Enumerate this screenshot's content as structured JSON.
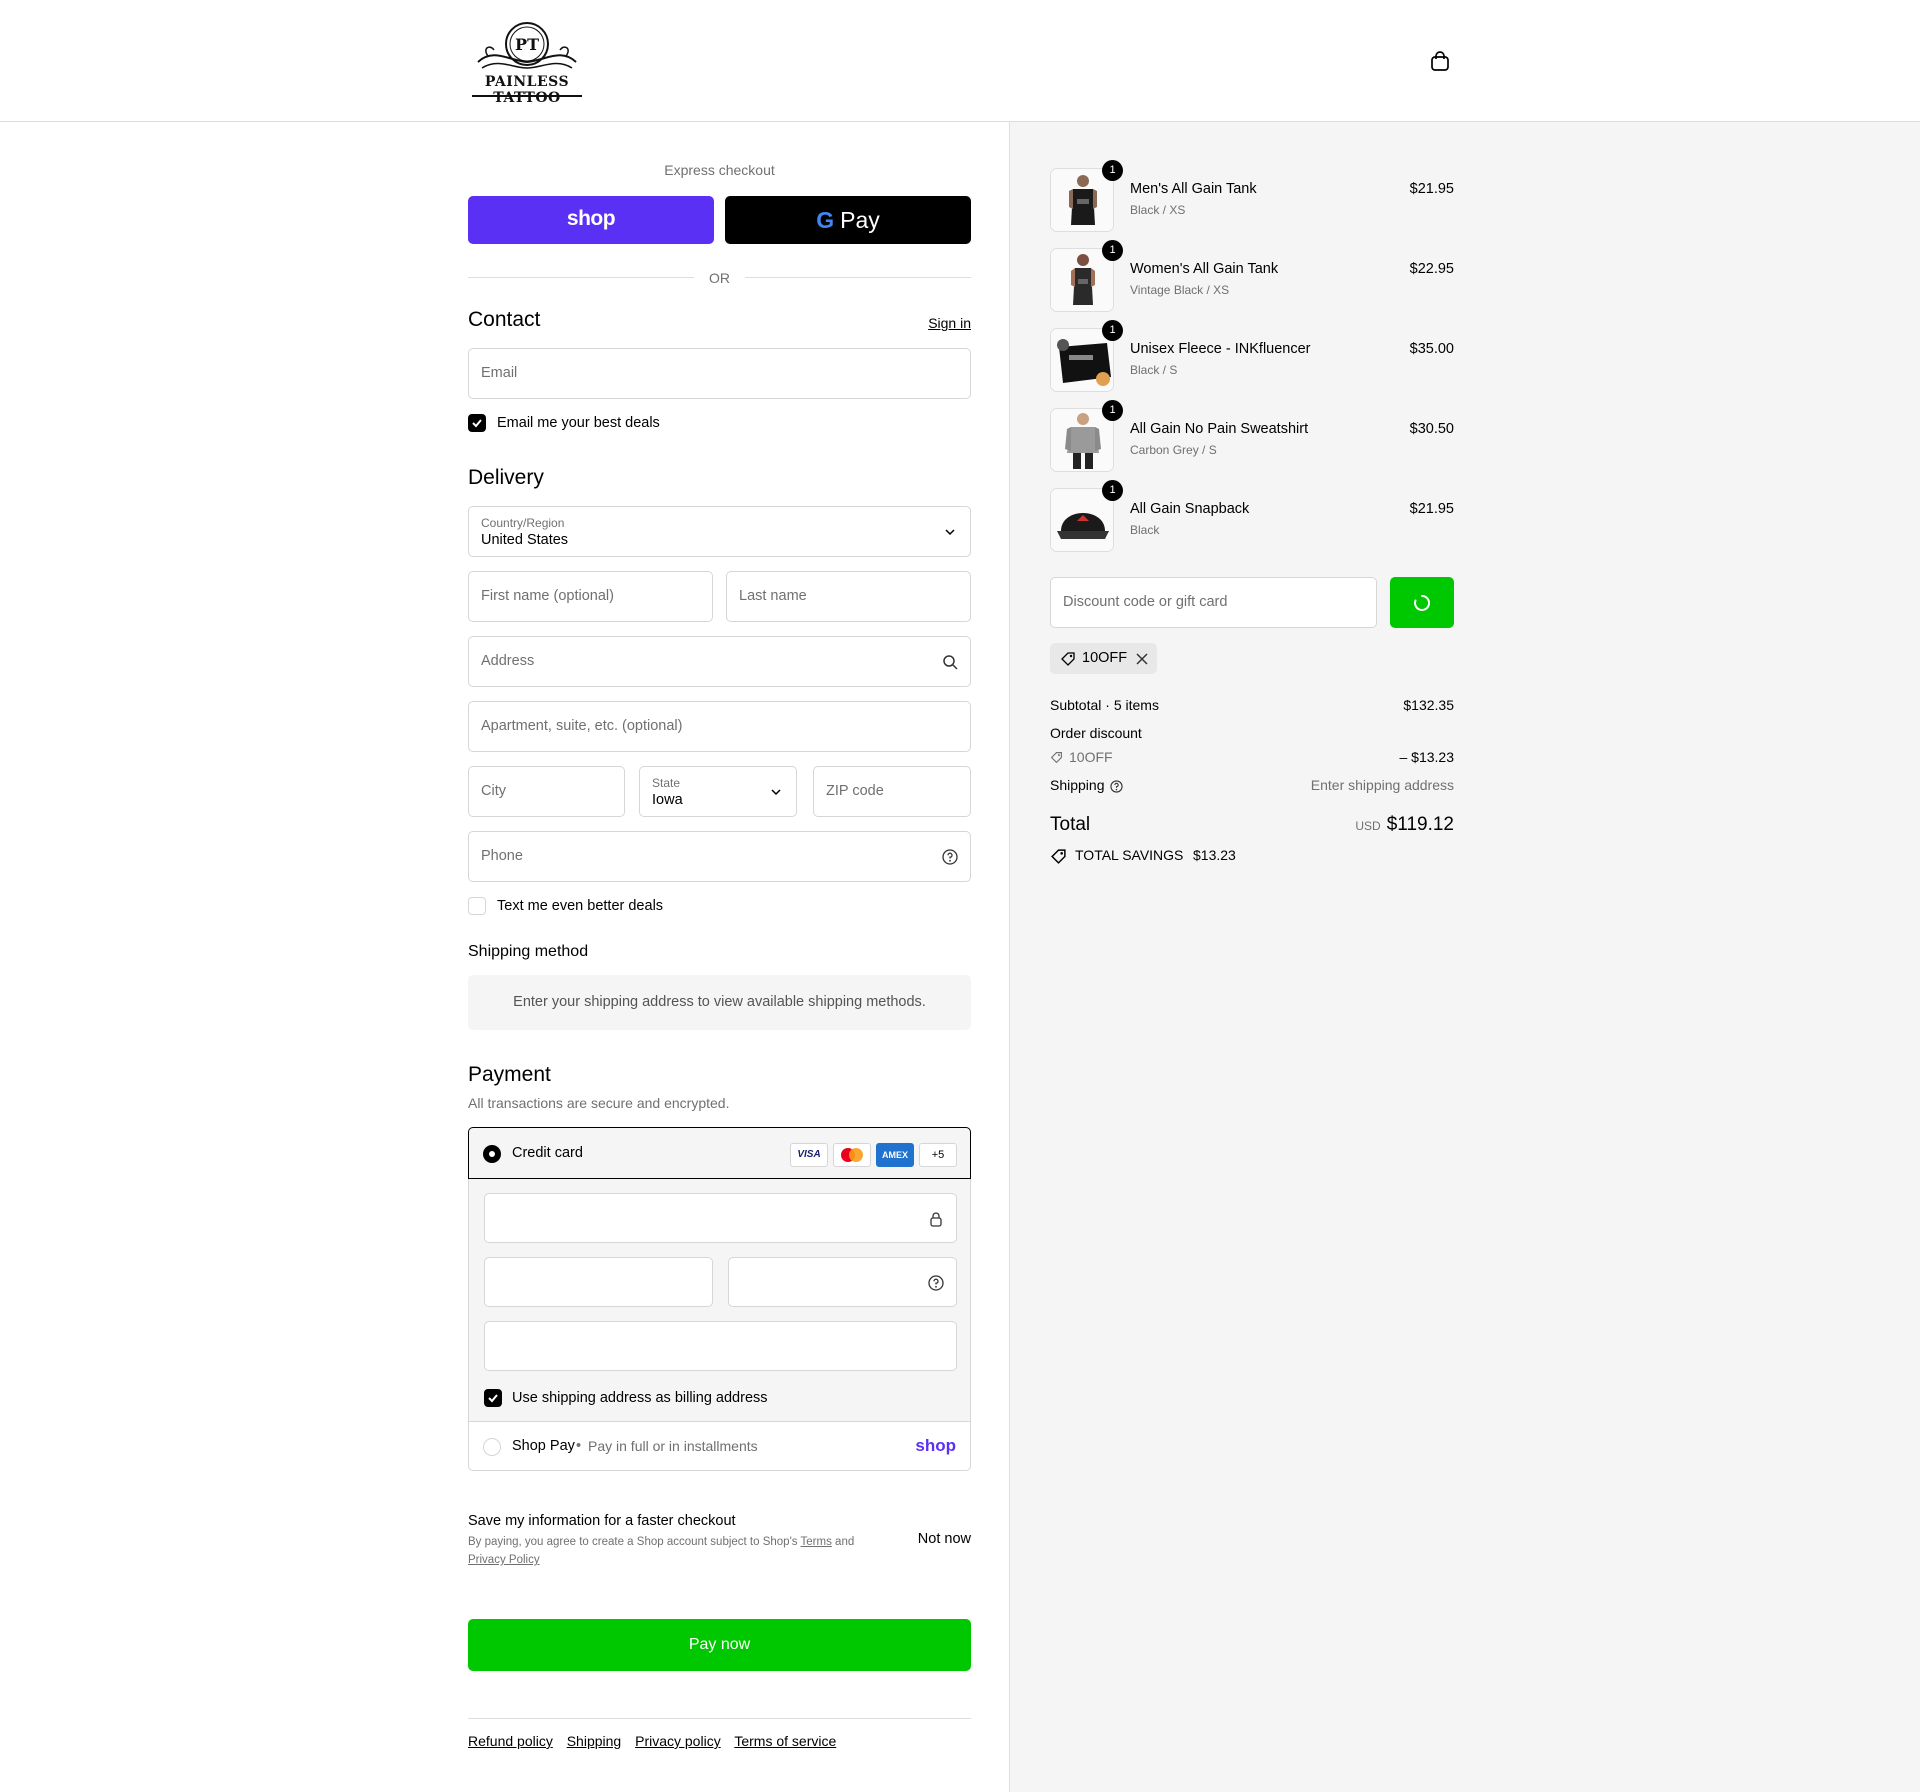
{
  "header": {
    "logo_mark": "PT",
    "logo_text": "PAINLESS TATTOO",
    "cart_icon": "shopping-bag-icon"
  },
  "express": {
    "label": "Express checkout",
    "shop_label": "shop",
    "gpay_label": "Pay",
    "or_label": "OR"
  },
  "contact": {
    "title": "Contact",
    "sign_in": "Sign in",
    "email_placeholder": "Email",
    "email_deals_label": "Email me your best deals",
    "email_deals_checked": true
  },
  "delivery": {
    "title": "Delivery",
    "country_label": "Country/Region",
    "country_value": "United States",
    "first_name_placeholder": "First name (optional)",
    "last_name_placeholder": "Last name",
    "address_placeholder": "Address",
    "apartment_placeholder": "Apartment, suite, etc. (optional)",
    "city_placeholder": "City",
    "state_label": "State",
    "state_value": "Iowa",
    "zip_placeholder": "ZIP code",
    "phone_placeholder": "Phone",
    "text_deals_label": "Text me even better deals",
    "text_deals_checked": false
  },
  "shipping_method": {
    "title": "Shipping method",
    "message": "Enter your shipping address to view available shipping methods."
  },
  "payment": {
    "title": "Payment",
    "subtitle": "All transactions are secure and encrypted.",
    "credit_card_label": "Credit card",
    "card_brands": [
      "VISA",
      "Mastercard",
      "AMEX"
    ],
    "more_brands": "+5",
    "billing_same_label": "Use shipping address as billing address",
    "billing_same_checked": true,
    "shop_pay_label": "Shop Pay",
    "shop_pay_desc": "Pay in full or in installments",
    "shop_pay_logo": "shop"
  },
  "save_info": {
    "title": "Save my information for a faster checkout",
    "legal_prefix": "By paying, you agree to create a Shop account subject to Shop's",
    "terms": "Terms",
    "and": "and",
    "privacy": "Privacy Policy",
    "not_now": "Not now"
  },
  "pay_now": "Pay now",
  "footer": {
    "links": [
      "Refund policy",
      "Shipping",
      "Privacy policy",
      "Terms of service"
    ]
  },
  "order": {
    "items": [
      {
        "name": "Men's All Gain Tank",
        "variant": "Black / XS",
        "price": "$21.95",
        "qty": "1"
      },
      {
        "name": "Women's All Gain Tank",
        "variant": "Vintage Black / XS",
        "price": "$22.95",
        "qty": "1"
      },
      {
        "name": "Unisex Fleece - INKfluencer",
        "variant": "Black / S",
        "price": "$35.00",
        "qty": "1"
      },
      {
        "name": "All Gain No Pain Sweatshirt",
        "variant": "Carbon Grey / S",
        "price": "$30.50",
        "qty": "1"
      },
      {
        "name": "All Gain Snapback",
        "variant": "Black",
        "price": "$21.95",
        "qty": "1"
      }
    ],
    "discount_placeholder": "Discount code or gift card",
    "applied_code": "10OFF",
    "subtotal_label": "Subtotal · 5 items",
    "subtotal_value": "$132.35",
    "order_discount_label": "Order discount",
    "discount_code": "10OFF",
    "discount_value": "– $13.23",
    "shipping_label": "Shipping",
    "shipping_value": "Enter shipping address",
    "total_label": "Total",
    "total_currency": "USD",
    "total_value": "$119.12",
    "savings_label": "TOTAL SAVINGS",
    "savings_value": "$13.23"
  },
  "colors": {
    "shop_purple": "#5a31f4",
    "pay_green": "#00c800",
    "summary_bg": "#f5f5f5"
  }
}
